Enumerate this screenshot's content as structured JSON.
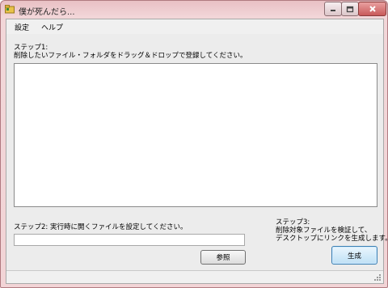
{
  "window": {
    "title": "僕が死んだら...",
    "icon": "folder-icon"
  },
  "titlebar_buttons": [
    "minimize-icon",
    "maximize-icon",
    "close-icon"
  ],
  "menu": {
    "items": [
      {
        "label": "設定"
      },
      {
        "label": "ヘルプ"
      }
    ]
  },
  "step1": {
    "label": "ステップ1:\n削除したいファイル・フォルダをドラッグ＆ドロップで登録してください。"
  },
  "step2": {
    "label": "ステップ2: 実行時に開くファイルを設定してください。",
    "path_value": "",
    "browse_label": "参照"
  },
  "step3": {
    "label": "ステップ3:\n削除対象ファイルを検証して、\nデスクトップにリンクを生成します。",
    "generate_label": "生成"
  },
  "colors": {
    "frame": "#f2d4d6",
    "client": "#ececec",
    "accent_button": "#bfe0f5"
  }
}
